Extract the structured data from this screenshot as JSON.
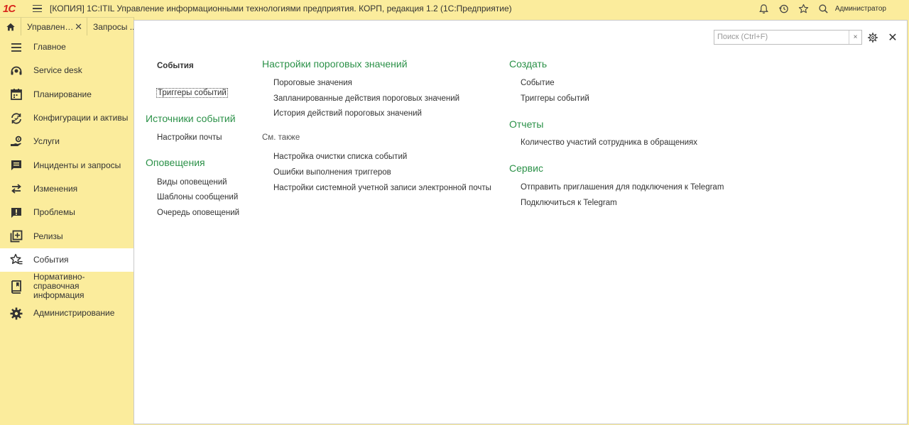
{
  "titlebar": {
    "logo": "1С",
    "title": "[КОПИЯ] 1С:ITIL Управление информационными технологиями предприятия. КОРП, редакция 1.2  (1С:Предприятие)",
    "user": "Администратор",
    "icons": [
      "bell-icon",
      "history-icon",
      "star-icon",
      "search-icon"
    ]
  },
  "tabs": [
    {
      "label": "Управлен…"
    },
    {
      "label": "Запросы ..."
    }
  ],
  "sidebar": {
    "items": [
      {
        "label": "Главное",
        "icon": "menu-lines-icon"
      },
      {
        "label": "Service desk",
        "icon": "headset-icon"
      },
      {
        "label": "Планирование",
        "icon": "calendar-icon"
      },
      {
        "label": "Конфигурации и активы",
        "icon": "cycle-icon"
      },
      {
        "label": "Услуги",
        "icon": "hand-service-icon"
      },
      {
        "label": "Инциденты и запросы",
        "icon": "chat-list-icon"
      },
      {
        "label": "Изменения",
        "icon": "swap-arrows-icon"
      },
      {
        "label": "Проблемы",
        "icon": "alert-chat-icon"
      },
      {
        "label": "Релизы",
        "icon": "add-stack-icon"
      },
      {
        "label": "События",
        "icon": "star-events-icon",
        "active": true
      },
      {
        "label": "Нормативно-справочная информация",
        "icon": "book-icon"
      },
      {
        "label": "Администрирование",
        "icon": "gear-icon"
      }
    ]
  },
  "panel": {
    "search_placeholder": "Поиск (Ctrl+F)",
    "search_clear": "×",
    "close": "✕",
    "col1": {
      "section_bold": "События",
      "focused_link": "Триггеры событий",
      "sources_title": "Источники событий",
      "sources_links": [
        "Настройки почты"
      ],
      "alerts_title": "Оповещения",
      "alerts_links": [
        "Виды оповещений",
        "Шаблоны сообщений",
        "Очередь оповещений"
      ]
    },
    "col2": {
      "title": "Настройки пороговых значений",
      "links": [
        "Пороговые значения",
        "Запланированные действия пороговых значений",
        "История действий пороговых значений"
      ],
      "see_also": "См. также",
      "see_links": [
        "Настройка очистки списка событий",
        "Ошибки выполнения триггеров",
        "Настройки системной учетной записи электронной почты"
      ]
    },
    "col3": {
      "create_title": "Создать",
      "create_links": [
        "Событие",
        "Триггеры событий"
      ],
      "reports_title": "Отчеты",
      "reports_links": [
        "Количество участий сотрудника в обращениях"
      ],
      "service_title": "Сервис",
      "service_links": [
        "Отправить приглашения для подключения к Telegram",
        "Подключиться к Telegram"
      ]
    }
  },
  "colors": {
    "background": "#fbec9c",
    "accent_green": "#2b9148",
    "logo_red": "#d8261c"
  }
}
